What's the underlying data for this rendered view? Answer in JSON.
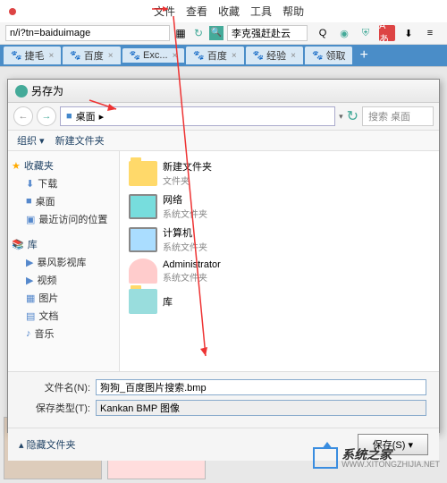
{
  "menu": {
    "file": "文件",
    "view": "查看",
    "fav": "收藏",
    "tools": "工具",
    "help": "帮助"
  },
  "url": "n/i?tn=baiduimage",
  "search_text": "李克强赶赴云",
  "tabs": [
    {
      "label": "捷毛"
    },
    {
      "label": "百度"
    },
    {
      "label": "Exc..."
    },
    {
      "label": "百度"
    },
    {
      "label": "经验"
    },
    {
      "label": "领取"
    }
  ],
  "dialog": {
    "title": "另存为",
    "location": "桌面",
    "search_ph": "搜索 桌面",
    "org": "组织",
    "newf": "新建文件夹",
    "fav": "收藏夹",
    "dl": "下载",
    "desktop": "桌面",
    "recent": "最近访问的位置",
    "lib": "库",
    "video": "暴风影视库",
    "vid2": "视频",
    "pic": "图片",
    "doc": "文档",
    "music": "音乐",
    "files": [
      {
        "name": "新建文件夹",
        "sub": "文件夹"
      },
      {
        "name": "网络",
        "sub": "系统文件夹"
      },
      {
        "name": "计算机",
        "sub": "系统文件夹"
      },
      {
        "name": "Administrator",
        "sub": "系统文件夹"
      },
      {
        "name": "库",
        "sub": ""
      }
    ],
    "fn_label": "文件名(N):",
    "fn_value": "狗狗_百度图片搜索.bmp",
    "ft_label": "保存类型(T):",
    "ft_value": "Kankan BMP 图像",
    "hide": "隐藏文件夹",
    "save": "保存(S)"
  },
  "watermark": {
    "main": "系统之家",
    "sub": "WWW.XITONGZHIJIA.NET"
  }
}
